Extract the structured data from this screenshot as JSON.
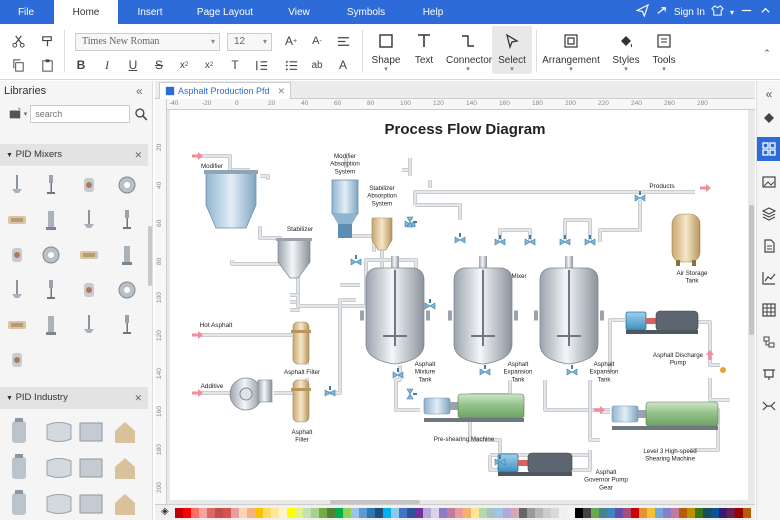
{
  "menu": {
    "tabs": [
      {
        "label": "File"
      },
      {
        "label": "Home"
      },
      {
        "label": "Insert"
      },
      {
        "label": "Page Layout"
      },
      {
        "label": "View"
      },
      {
        "label": "Symbols"
      },
      {
        "label": "Help"
      }
    ],
    "active_tab": "Home",
    "sign_in": "Sign In"
  },
  "ribbon": {
    "font_name": "Times New Roman",
    "font_size": "12",
    "tools": [
      {
        "label": "Shape"
      },
      {
        "label": "Text"
      },
      {
        "label": "Connector"
      },
      {
        "label": "Select"
      },
      {
        "label": "Arrangement"
      },
      {
        "label": "Styles"
      },
      {
        "label": "Tools"
      }
    ]
  },
  "libraries": {
    "title": "Libraries",
    "search_placeholder": "search",
    "sections": [
      {
        "name": "PID Mixers"
      },
      {
        "name": "PID Industry"
      }
    ]
  },
  "document": {
    "tab_name": "Asphalt Production Pfd"
  },
  "rulers": {
    "h": [
      "-40",
      "-20",
      "0",
      "20",
      "40",
      "60",
      "80",
      "100",
      "120",
      "140",
      "160",
      "180",
      "200",
      "220",
      "240",
      "260",
      "280"
    ],
    "v": [
      "20",
      "40",
      "60",
      "80",
      "100",
      "120",
      "140",
      "160",
      "180",
      "200"
    ]
  },
  "diagram": {
    "title": "Process Flow Diagram",
    "labels": {
      "modifier": "Modifier",
      "modifier_absorption": "Modifier\nAbsorption\nSystem",
      "stabilizer_absorption": "Stabilizer\nAbsorption\nSystem",
      "stabilizer": "Stabilizer",
      "products": "Products",
      "mixer": "Mixer",
      "air_storage": "Air Storage\nTank",
      "hot_asphalt": "Hot Asphalt",
      "asphalt_filter": "Asphalt Filter",
      "additive": "Additive",
      "asphalt_filler": "Asphalt\nFiller",
      "mixture_tank": "Asphalt\nMixture\nTank",
      "expansion_tank_1": "Asphalt\nExpansion\nTank",
      "expansion_tank_2": "Asphalt\nExpansion\nTank",
      "discharge_pump": "Asphalt Discharge\nPump",
      "preshearing": "Pre-shearing Machine",
      "level3": "Level 3 High-speed\nShearing Machine",
      "governor_pump": "Asphalt\nGovernor Pump\nGear"
    }
  },
  "colors": {
    "accent": "#2d6cd8",
    "pipe": "#c9ccd1",
    "arrow": "#f28c9a"
  }
}
